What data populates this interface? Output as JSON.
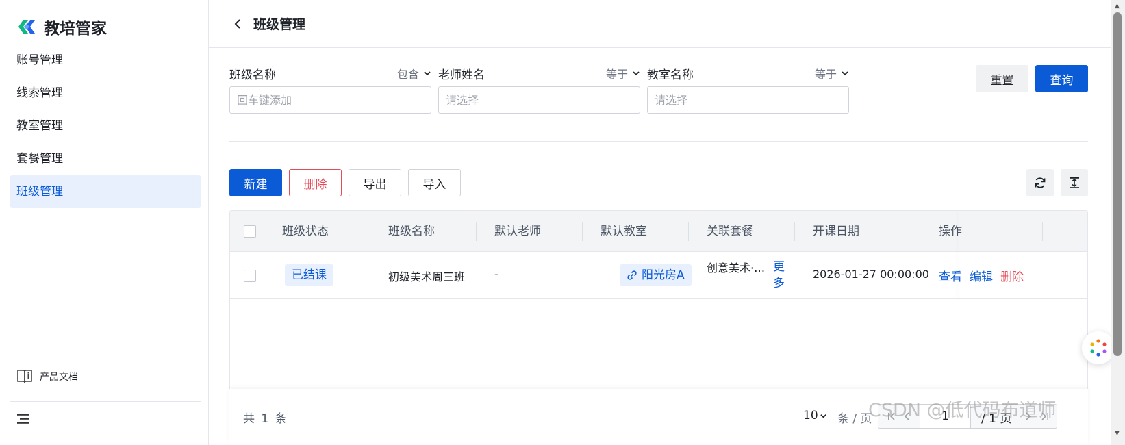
{
  "app": {
    "title": "教培管家"
  },
  "sidebar": {
    "items": [
      {
        "label": "账号管理",
        "active": false
      },
      {
        "label": "线索管理",
        "active": false
      },
      {
        "label": "教室管理",
        "active": false
      },
      {
        "label": "套餐管理",
        "active": false
      },
      {
        "label": "班级管理",
        "active": true
      }
    ],
    "doc_link": "产品文档"
  },
  "header": {
    "title": "班级管理"
  },
  "filters": [
    {
      "label": "班级名称",
      "operator": "包含",
      "placeholder": "回车键添加"
    },
    {
      "label": "老师姓名",
      "operator": "等于",
      "placeholder": "请选择"
    },
    {
      "label": "教室名称",
      "operator": "等于",
      "placeholder": "请选择"
    }
  ],
  "actions": {
    "reset": "重置",
    "query": "查询"
  },
  "toolbar": {
    "new": "新建",
    "delete": "删除",
    "export": "导出",
    "import": "导入"
  },
  "table": {
    "columns": [
      "班级状态",
      "班级名称",
      "默认老师",
      "默认教室",
      "关联套餐",
      "开课日期",
      "操作"
    ],
    "rows": [
      {
        "status": "已结课",
        "name": "初级美术周三班",
        "teacher": "-",
        "room": "阳光房A",
        "package": "创意美术·…",
        "package_more": "更多",
        "start_date": "2026-01-27 00:00:00",
        "ops": {
          "view": "查看",
          "edit": "编辑",
          "delete": "删除"
        }
      }
    ]
  },
  "pagination": {
    "total_prefix": "共",
    "total": "1",
    "total_suffix": "条",
    "page_size": "10",
    "per_page_label": "条 / 页",
    "current_page": "1",
    "total_pages_label": "/ 1 页"
  },
  "watermark": "CSDN @低代码布道师",
  "colors": {
    "primary": "#0b5bd7",
    "danger": "#e34d59",
    "active_bg": "#e8f0fe"
  },
  "icons": [
    "brand-logo-icon",
    "book-icon",
    "menu-collapse-icon",
    "chevron-left-icon",
    "chevron-down-icon",
    "refresh-icon",
    "fit-height-icon",
    "link-icon",
    "assistant-icon"
  ]
}
